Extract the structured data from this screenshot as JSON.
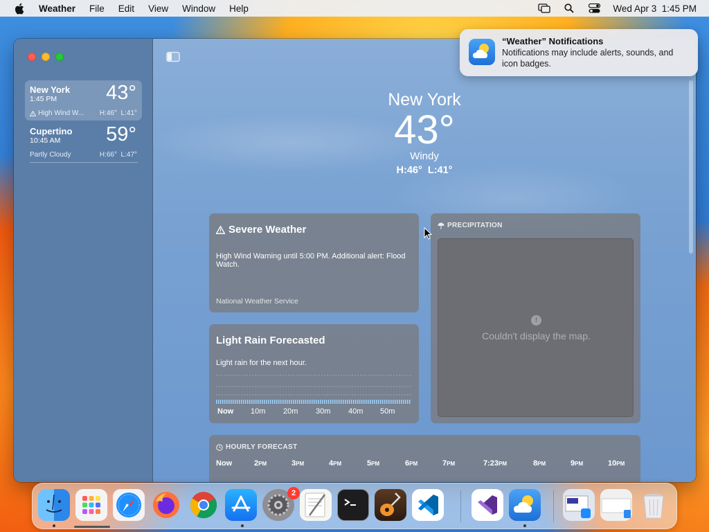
{
  "menubar": {
    "app_name": "Weather",
    "items": [
      "File",
      "Edit",
      "View",
      "Window",
      "Help"
    ],
    "datetime": "Wed Apr 3  1:45 PM"
  },
  "sidebar": {
    "locations": [
      {
        "name": "New York",
        "time": "1:45 PM",
        "temp": "43°",
        "condition": "High Wind W...",
        "hilo": "H:46°  L:41°",
        "selected": true
      },
      {
        "name": "Cupertino",
        "time": "10:45 AM",
        "temp": "59°",
        "condition": "Partly Cloudy",
        "hilo": "H:66°  L:47°",
        "selected": false
      }
    ]
  },
  "hero": {
    "city": "New York",
    "temp": "43°",
    "condition": "Windy",
    "hilo": "H:46°  L:41°"
  },
  "severe": {
    "title": "Severe Weather",
    "text": "High Wind Warning until 5:00 PM. Additional alert: Flood Watch.",
    "source": "National Weather Service"
  },
  "rain": {
    "title": "Light Rain Forecasted",
    "text": "Light rain for the next hour.",
    "axis": [
      "Now",
      "10m",
      "20m",
      "30m",
      "40m",
      "50m"
    ]
  },
  "precip": {
    "header": "PRECIPITATION",
    "message": "Couldn't display the map."
  },
  "hourly": {
    "header": "HOURLY FORECAST",
    "hours": [
      {
        "h": "Now",
        "s": ""
      },
      {
        "h": "2",
        "s": "PM"
      },
      {
        "h": "3",
        "s": "PM"
      },
      {
        "h": "4",
        "s": "PM"
      },
      {
        "h": "5",
        "s": "PM"
      },
      {
        "h": "6",
        "s": "PM"
      },
      {
        "h": "7",
        "s": "PM"
      },
      {
        "h": "7:23",
        "s": "PM"
      },
      {
        "h": "8",
        "s": "PM"
      },
      {
        "h": "9",
        "s": "PM"
      },
      {
        "h": "10",
        "s": "PM"
      }
    ]
  },
  "notification": {
    "title": "“Weather” Notifications",
    "body": "Notifications may include alerts, sounds, and icon badges."
  },
  "dock": {
    "apps": [
      {
        "name": "finder-icon",
        "color": "#2a8cf0",
        "running": true
      },
      {
        "name": "launchpad-icon",
        "color": "#f2f2f2",
        "running": false
      },
      {
        "name": "safari-icon",
        "color": "#1e90ff",
        "running": false
      },
      {
        "name": "firefox-icon",
        "color": "#ff7139",
        "running": false
      },
      {
        "name": "chrome-icon",
        "color": "#ffffff",
        "running": false
      },
      {
        "name": "app-store-icon",
        "color": "#1a8cff",
        "running": true
      },
      {
        "name": "system-settings-icon",
        "color": "#8e8e93",
        "running": false
      },
      {
        "name": "textedit-icon",
        "color": "#f7f7f2",
        "running": false
      },
      {
        "name": "terminal-icon",
        "color": "#1d1d1f",
        "running": false
      },
      {
        "name": "garageband-icon",
        "color": "#3a2a1a",
        "running": false
      },
      {
        "name": "vscode-icon",
        "color": "#ffffff",
        "running": false
      },
      {
        "name": "visual-studio-icon",
        "color": "#ffffff",
        "running": false
      },
      {
        "name": "weather-icon",
        "color": "#2f86e8",
        "running": true
      },
      {
        "name": "app-store-downloads-icon",
        "color": "#dfe6ef",
        "running": false
      },
      {
        "name": "finder-window-icon",
        "color": "#f0f0f0",
        "running": false
      },
      {
        "name": "trash-icon",
        "color": "#e4e4e8",
        "running": false
      }
    ],
    "settings_badge": "2"
  }
}
